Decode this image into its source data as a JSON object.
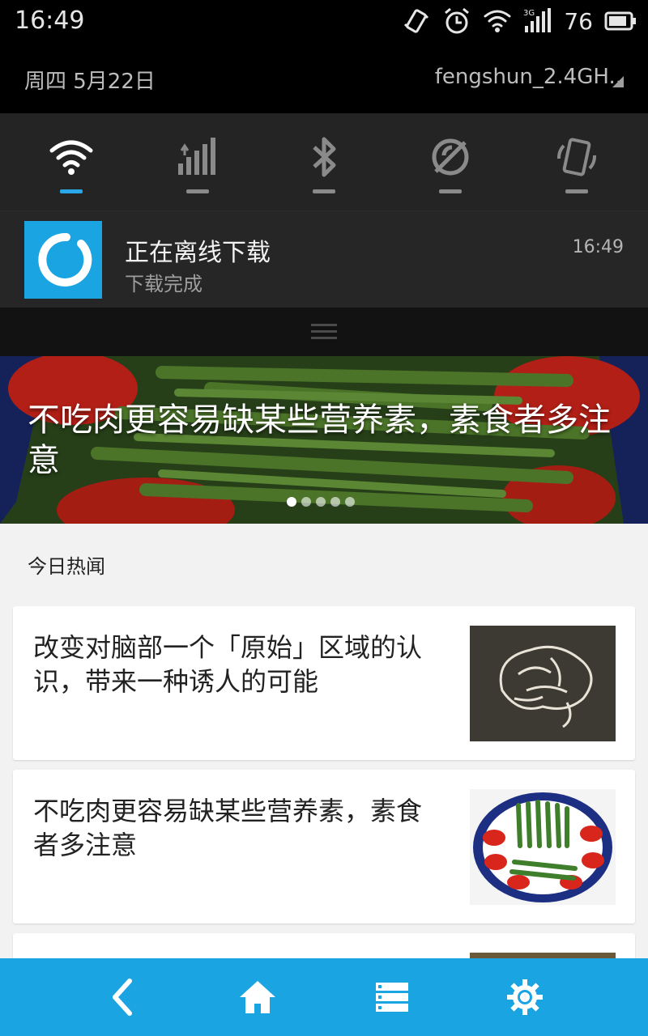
{
  "status_bar": {
    "time": "16:49",
    "battery_level": "76",
    "icons": [
      "vibrate-icon",
      "alarm-icon",
      "wifi-icon",
      "3g-signal-icon",
      "battery-icon"
    ]
  },
  "shade": {
    "date": "周四  5月22日",
    "ssid": "fengshun_2.4GH..",
    "quick_settings": [
      {
        "name": "wifi",
        "icon": "wifi-icon",
        "on": true
      },
      {
        "name": "mobile-data",
        "icon": "signal-icon",
        "on": false
      },
      {
        "name": "bluetooth",
        "icon": "bluetooth-icon",
        "on": false
      },
      {
        "name": "location",
        "icon": "location-off-icon",
        "on": false
      },
      {
        "name": "auto-rotate",
        "icon": "rotate-icon",
        "on": false
      }
    ],
    "notification": {
      "title": "正在离线下载",
      "subtitle": "下载完成",
      "time": "16:49"
    }
  },
  "hero": {
    "title": "不吃肉更容易缺某些营养素，素食者多注意",
    "page_count": 5,
    "active_page": 1
  },
  "section": {
    "label": "今日热闻"
  },
  "articles": [
    {
      "title": "改变对脑部一个「原始」区域的认识，带来一种诱人的可能",
      "thumb": "brain-image"
    },
    {
      "title": "不吃肉更容易缺某些营养素，素食者多注意",
      "thumb": "vegetable-plate-image"
    }
  ],
  "bottom_nav": {
    "items": [
      "back-icon",
      "home-icon",
      "list-icon",
      "settings-icon"
    ]
  },
  "colors": {
    "accent": "#1aa4e2",
    "shade_bg": "#141414"
  }
}
